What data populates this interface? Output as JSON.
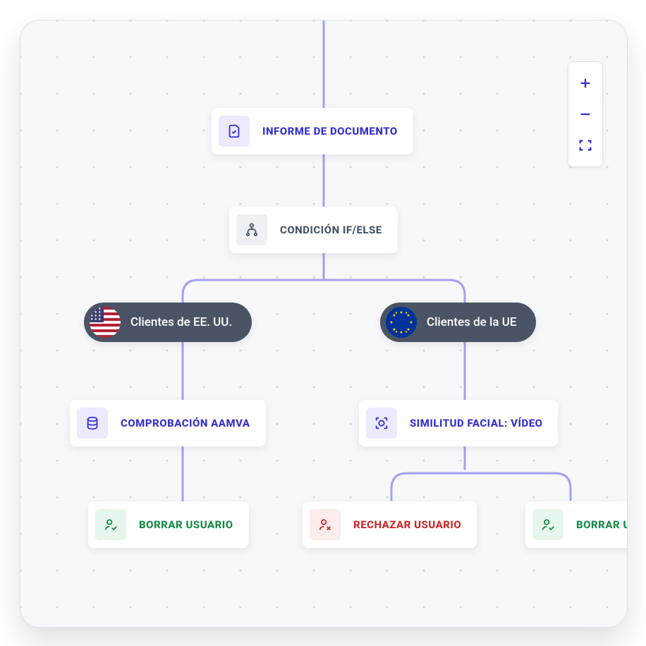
{
  "canvas": {
    "zoom_controls": {
      "in": "+",
      "out": "−",
      "fit": "⛶"
    }
  },
  "nodes": {
    "doc_report": {
      "label": "INFORME DE DOCUMENTO"
    },
    "condition": {
      "label": "CONDICIÓN IF/ELSE"
    },
    "aamva": {
      "label": "COMPROBACIÓN AAMVA"
    },
    "facial": {
      "label": "SIMILITUD FACIAL: VÍDEO"
    },
    "clear_user_1": {
      "label": "BORRAR USUARIO"
    },
    "reject_user": {
      "label": "RECHAZAR USUARIO"
    },
    "clear_user_2": {
      "label": "BORRAR USUARIO"
    }
  },
  "branches": {
    "us": {
      "label": "Clientes de EE. UU."
    },
    "eu": {
      "label": "Clientes de la UE"
    }
  }
}
